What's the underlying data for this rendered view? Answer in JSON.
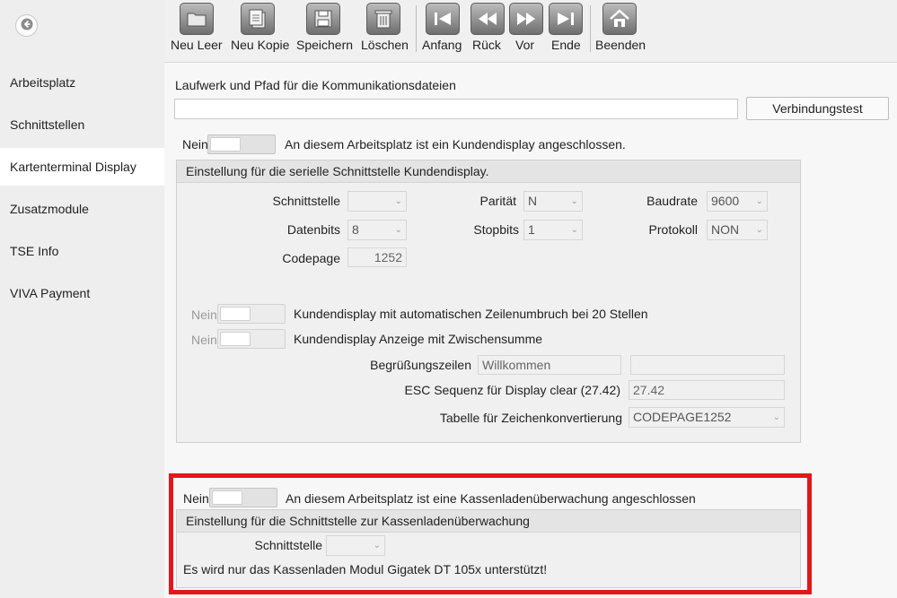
{
  "sidebar": {
    "items": [
      {
        "label": "Arbeitsplatz",
        "active": false
      },
      {
        "label": "Schnittstellen",
        "active": false
      },
      {
        "label": "Kartenterminal Display",
        "active": true
      },
      {
        "label": "Zusatzmodule",
        "active": false
      },
      {
        "label": "TSE Info",
        "active": false
      },
      {
        "label": "VIVA Payment",
        "active": false
      }
    ]
  },
  "toolbar": {
    "neu_leer": "Neu Leer",
    "neu_kopie": "Neu Kopie",
    "speichern": "Speichern",
    "loeschen": "Löschen",
    "anfang": "Anfang",
    "rueck": "Rück",
    "vor": "Vor",
    "ende": "Ende",
    "beenden": "Beenden"
  },
  "comm": {
    "label": "Laufwerk und Pfad für die Kommunikationsdateien",
    "path_value": "",
    "test_button": "Verbindungstest"
  },
  "kundendisplay": {
    "toggle_state": "Nein",
    "toggle_text": "An diesem Arbeitsplatz ist ein Kundendisplay angeschlossen.",
    "group_title": "Einstellung für die serielle Schnittstelle Kundendisplay.",
    "schnittstelle_label": "Schnittstelle",
    "schnittstelle_value": "",
    "paritaet_label": "Parität",
    "paritaet_value": "N",
    "baudrate_label": "Baudrate",
    "baudrate_value": "9600",
    "datenbits_label": "Datenbits",
    "datenbits_value": "8",
    "stopbits_label": "Stopbits",
    "stopbits_value": "1",
    "protokoll_label": "Protokoll",
    "protokoll_value": "NON",
    "codepage_label": "Codepage",
    "codepage_value": "1252",
    "umbruch_state": "Nein",
    "umbruch_text": "Kundendisplay mit automatischen Zeilenumbruch bei 20 Stellen",
    "zwischensumme_state": "Nein",
    "zwischensumme_text": "Kundendisplay Anzeige mit Zwischensumme",
    "begruessung_label": "Begrüßungszeilen",
    "begruessung_value1": "Willkommen",
    "begruessung_value2": "",
    "esc_label": "ESC Sequenz für Display clear (27.42)",
    "esc_value": "27.42",
    "tabelle_label": "Tabelle für Zeichenkonvertierung",
    "tabelle_value": "CODEPAGE1252"
  },
  "kassenlade": {
    "toggle_state": "Nein",
    "toggle_text": "An diesem Arbeitsplatz ist eine Kassenladenüberwachung angeschlossen",
    "group_title": "Einstellung für die Schnittstelle zur Kassenladenüberwachung",
    "schnittstelle_label": "Schnittstelle",
    "schnittstelle_value": "",
    "info_text": "Es wird nur das Kassenladen Modul Gigatek DT 105x unterstützt!"
  },
  "colors": {
    "highlight_border": "#e3161b",
    "sidebar_bg": "#eeeeee",
    "active_item_bg": "#ffffff"
  }
}
